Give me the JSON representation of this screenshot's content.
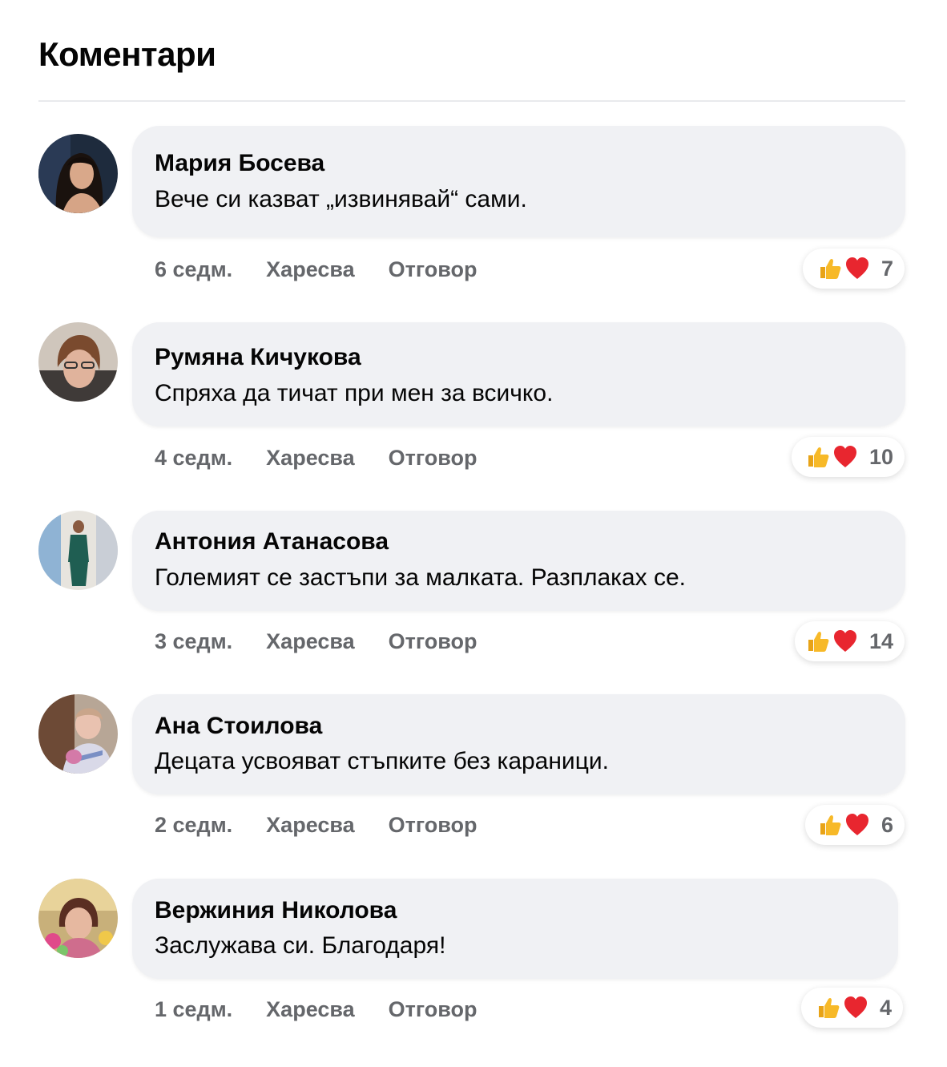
{
  "header": {
    "title": "Коментари"
  },
  "labels": {
    "like": "Харесва",
    "reply": "Отговор"
  },
  "comments": [
    {
      "author": "Мария Босева",
      "text": "Вече си казват „извинявай“ сами.",
      "time": "6 седм.",
      "reactions": [
        "like",
        "love"
      ],
      "reaction_count": "7"
    },
    {
      "author": "Румяна Кичукова",
      "text": "Спряха да тичат при мен за всичко.",
      "time": "4 седм.",
      "reactions": [
        "like",
        "love"
      ],
      "reaction_count": "10"
    },
    {
      "author": "Антония Атанасова",
      "text": "Големият се застъпи за малката. Разплаках се.",
      "time": "3 седм.",
      "reactions": [
        "like",
        "love"
      ],
      "reaction_count": "14"
    },
    {
      "author": "Ана Стоилова",
      "text": "Децата усвояват стъпките без караници.",
      "time": "2 седм.",
      "reactions": [
        "like",
        "love"
      ],
      "reaction_count": "6"
    },
    {
      "author": "Вержиния Николова",
      "text": "Заслужава си. Благодаря!",
      "time": "1 седм.",
      "reactions": [
        "like",
        "love"
      ],
      "reaction_count": "4"
    }
  ],
  "colors": {
    "bubble": "#f0f1f4",
    "meta_text": "#65676b",
    "love": "#e8262f",
    "like": "#f7b928"
  }
}
